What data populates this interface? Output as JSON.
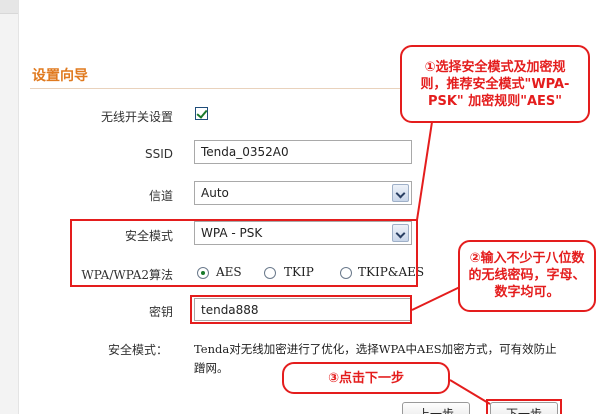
{
  "wizard": {
    "title": "设置向导",
    "wireless_switch": {
      "label": "无线开关设置",
      "checked": true
    },
    "ssid": {
      "label": "SSID",
      "value": "Tenda_0352A0"
    },
    "channel": {
      "label": "信道",
      "value": "Auto"
    },
    "security_mode": {
      "label": "安全模式",
      "value": "WPA - PSK"
    },
    "wpa_algorithm": {
      "label": "WPA/WPA2算法",
      "options": [
        "AES",
        "TKIP",
        "TKIP&AES"
      ],
      "selected": "AES"
    },
    "key": {
      "label": "密钥",
      "value": "tenda888"
    },
    "note": {
      "label": "安全模式：",
      "text": "Tenda对无线加密进行了优化，选择WPA中AES加密方式，可有效防止蹭网。"
    },
    "buttons": {
      "prev": "上一步",
      "next": "下一步"
    }
  },
  "annotations": {
    "step1": {
      "line1": "①选择安全模式及加密规",
      "line2": "则，推荐安全模式\"WPA-",
      "line3": "PSK\" 加密规则\"AES\""
    },
    "step2": {
      "line1": "②输入不少于八位数",
      "line2": "的无线密码，字母、",
      "line3": "数字均可。"
    },
    "step3": {
      "text": "③点击下一步"
    }
  },
  "colors": {
    "annotation": "#e41d1d",
    "title": "#e07a1f"
  }
}
